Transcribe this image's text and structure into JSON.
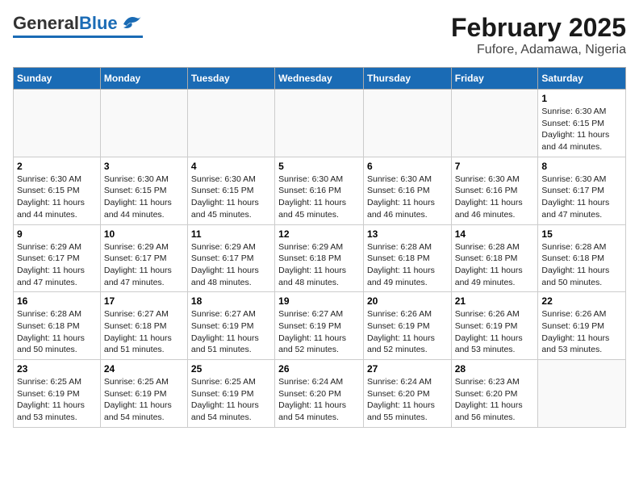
{
  "logo": {
    "general": "General",
    "blue": "Blue"
  },
  "title": {
    "month": "February 2025",
    "location": "Fufore, Adamawa, Nigeria"
  },
  "weekdays": [
    "Sunday",
    "Monday",
    "Tuesday",
    "Wednesday",
    "Thursday",
    "Friday",
    "Saturday"
  ],
  "weeks": [
    [
      {
        "day": "",
        "info": ""
      },
      {
        "day": "",
        "info": ""
      },
      {
        "day": "",
        "info": ""
      },
      {
        "day": "",
        "info": ""
      },
      {
        "day": "",
        "info": ""
      },
      {
        "day": "",
        "info": ""
      },
      {
        "day": "1",
        "info": "Sunrise: 6:30 AM\nSunset: 6:15 PM\nDaylight: 11 hours\nand 44 minutes."
      }
    ],
    [
      {
        "day": "2",
        "info": "Sunrise: 6:30 AM\nSunset: 6:15 PM\nDaylight: 11 hours\nand 44 minutes."
      },
      {
        "day": "3",
        "info": "Sunrise: 6:30 AM\nSunset: 6:15 PM\nDaylight: 11 hours\nand 44 minutes."
      },
      {
        "day": "4",
        "info": "Sunrise: 6:30 AM\nSunset: 6:15 PM\nDaylight: 11 hours\nand 45 minutes."
      },
      {
        "day": "5",
        "info": "Sunrise: 6:30 AM\nSunset: 6:16 PM\nDaylight: 11 hours\nand 45 minutes."
      },
      {
        "day": "6",
        "info": "Sunrise: 6:30 AM\nSunset: 6:16 PM\nDaylight: 11 hours\nand 46 minutes."
      },
      {
        "day": "7",
        "info": "Sunrise: 6:30 AM\nSunset: 6:16 PM\nDaylight: 11 hours\nand 46 minutes."
      },
      {
        "day": "8",
        "info": "Sunrise: 6:30 AM\nSunset: 6:17 PM\nDaylight: 11 hours\nand 47 minutes."
      }
    ],
    [
      {
        "day": "9",
        "info": "Sunrise: 6:29 AM\nSunset: 6:17 PM\nDaylight: 11 hours\nand 47 minutes."
      },
      {
        "day": "10",
        "info": "Sunrise: 6:29 AM\nSunset: 6:17 PM\nDaylight: 11 hours\nand 47 minutes."
      },
      {
        "day": "11",
        "info": "Sunrise: 6:29 AM\nSunset: 6:17 PM\nDaylight: 11 hours\nand 48 minutes."
      },
      {
        "day": "12",
        "info": "Sunrise: 6:29 AM\nSunset: 6:18 PM\nDaylight: 11 hours\nand 48 minutes."
      },
      {
        "day": "13",
        "info": "Sunrise: 6:28 AM\nSunset: 6:18 PM\nDaylight: 11 hours\nand 49 minutes."
      },
      {
        "day": "14",
        "info": "Sunrise: 6:28 AM\nSunset: 6:18 PM\nDaylight: 11 hours\nand 49 minutes."
      },
      {
        "day": "15",
        "info": "Sunrise: 6:28 AM\nSunset: 6:18 PM\nDaylight: 11 hours\nand 50 minutes."
      }
    ],
    [
      {
        "day": "16",
        "info": "Sunrise: 6:28 AM\nSunset: 6:18 PM\nDaylight: 11 hours\nand 50 minutes."
      },
      {
        "day": "17",
        "info": "Sunrise: 6:27 AM\nSunset: 6:18 PM\nDaylight: 11 hours\nand 51 minutes."
      },
      {
        "day": "18",
        "info": "Sunrise: 6:27 AM\nSunset: 6:19 PM\nDaylight: 11 hours\nand 51 minutes."
      },
      {
        "day": "19",
        "info": "Sunrise: 6:27 AM\nSunset: 6:19 PM\nDaylight: 11 hours\nand 52 minutes."
      },
      {
        "day": "20",
        "info": "Sunrise: 6:26 AM\nSunset: 6:19 PM\nDaylight: 11 hours\nand 52 minutes."
      },
      {
        "day": "21",
        "info": "Sunrise: 6:26 AM\nSunset: 6:19 PM\nDaylight: 11 hours\nand 53 minutes."
      },
      {
        "day": "22",
        "info": "Sunrise: 6:26 AM\nSunset: 6:19 PM\nDaylight: 11 hours\nand 53 minutes."
      }
    ],
    [
      {
        "day": "23",
        "info": "Sunrise: 6:25 AM\nSunset: 6:19 PM\nDaylight: 11 hours\nand 53 minutes."
      },
      {
        "day": "24",
        "info": "Sunrise: 6:25 AM\nSunset: 6:19 PM\nDaylight: 11 hours\nand 54 minutes."
      },
      {
        "day": "25",
        "info": "Sunrise: 6:25 AM\nSunset: 6:19 PM\nDaylight: 11 hours\nand 54 minutes."
      },
      {
        "day": "26",
        "info": "Sunrise: 6:24 AM\nSunset: 6:20 PM\nDaylight: 11 hours\nand 54 minutes."
      },
      {
        "day": "27",
        "info": "Sunrise: 6:24 AM\nSunset: 6:20 PM\nDaylight: 11 hours\nand 55 minutes."
      },
      {
        "day": "28",
        "info": "Sunrise: 6:23 AM\nSunset: 6:20 PM\nDaylight: 11 hours\nand 56 minutes."
      },
      {
        "day": "",
        "info": ""
      }
    ]
  ]
}
